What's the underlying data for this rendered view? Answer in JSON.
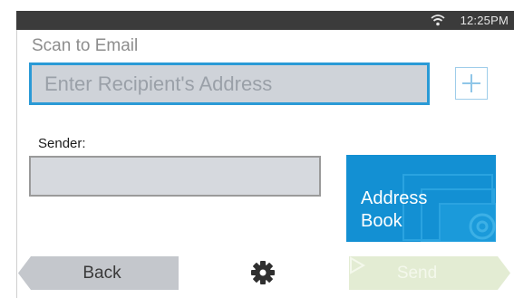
{
  "status_bar": {
    "time": "12:25PM",
    "wifi_icon": "wifi-icon"
  },
  "page": {
    "title": "Scan to Email"
  },
  "recipient": {
    "placeholder": "Enter Recipient's Address",
    "value": ""
  },
  "add_button": {
    "icon": "plus-icon"
  },
  "sender": {
    "label": "Sender:",
    "value": ""
  },
  "address_book_button": {
    "label": "Address\nBook",
    "icon": "at-sign-icon"
  },
  "bottom_bar": {
    "back_label": "Back",
    "settings_icon": "gear-icon",
    "send_label": "Send",
    "send_icon": "play-arrow-icon"
  },
  "colors": {
    "accent": "#1390d3",
    "status_bar": "#3b3b3b",
    "input_focus_border": "#2a9ad6",
    "input_bg": "#cfd3d9",
    "back_button": "#c4c7cc",
    "send_button_disabled": "#e3ecd3"
  }
}
